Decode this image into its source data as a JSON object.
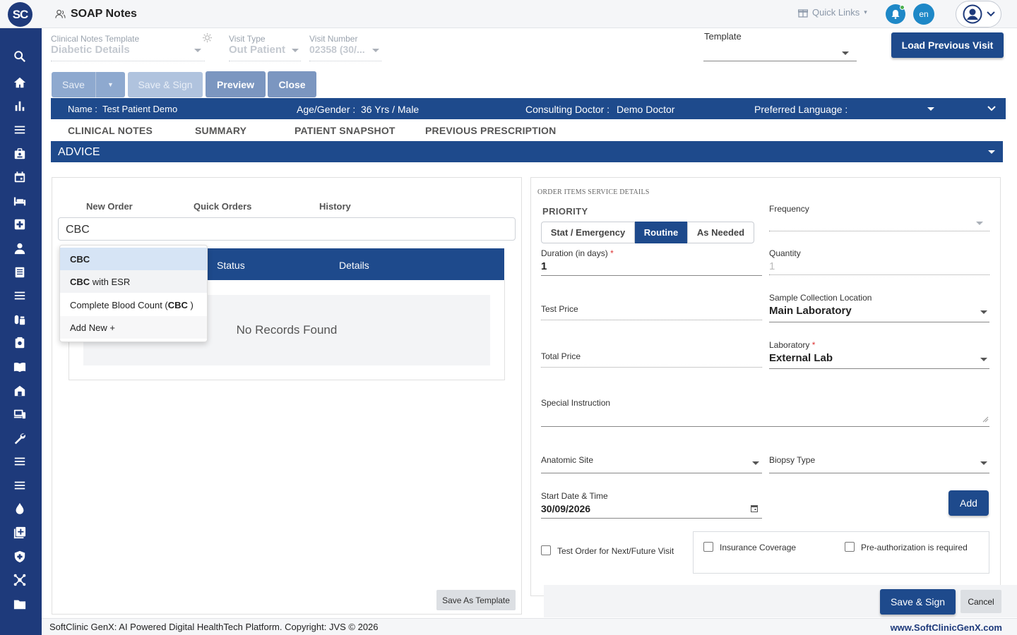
{
  "header": {
    "logo_text": "SC",
    "app_title": "SOAP Notes",
    "quick_links": "Quick Links",
    "lang_badge": "en"
  },
  "form": {
    "clinical_template_label": "Clinical Notes Template",
    "clinical_template_value": "Diabetic Details",
    "visit_type_label": "Visit Type",
    "visit_type_value": "Out Patient",
    "visit_number_label": "Visit Number",
    "visit_number_value": "02358 (30/...",
    "template_label": "Template",
    "load_previous_label": "Load Previous Visit"
  },
  "toolbar": {
    "save_label": "Save",
    "save_sign_label": "Save & Sign",
    "preview_label": "Preview",
    "close_label": "Close"
  },
  "patient": {
    "name_label": "Name :",
    "name_value": "Test Patient Demo",
    "age_label": "Age/Gender :",
    "age_value": "36 Yrs / Male",
    "doctor_label": "Consulting Doctor :",
    "doctor_value": "Demo Doctor",
    "language_label": "Preferred Language :"
  },
  "tabs": [
    "CLINICAL NOTES",
    "SUMMARY",
    "PATIENT SNAPSHOT",
    "PREVIOUS PRESCRIPTION"
  ],
  "section_title": "ADVICE",
  "orders": {
    "subtabs": [
      "New Order",
      "Quick Orders",
      "History"
    ],
    "search_value": "CBC",
    "columns": [
      "Status",
      "Details"
    ],
    "empty_message": "No Records Found",
    "suggestions": [
      {
        "bold": "CBC",
        "rest": ""
      },
      {
        "bold": "CBC",
        "rest": " with ESR"
      },
      {
        "pre": "Complete Blood Count (",
        "bold": "CBC",
        "post": " )"
      },
      {
        "pre": "Add New +"
      }
    ],
    "save_template_label": "Save As Template"
  },
  "service_details": {
    "header": "ORDER ITEMS SERVICE DETAILS",
    "priority_label": "PRIORITY",
    "priority_options": [
      "Stat / Emergency",
      "Routine",
      "As Needed"
    ],
    "priority_selected": "Routine",
    "frequency_label": "Frequency",
    "duration_label": "Duration (in days)",
    "duration_value": "1",
    "quantity_label": "Quantity",
    "quantity_value": "1",
    "test_price_label": "Test Price",
    "sample_location_label": "Sample Collection Location",
    "sample_location_value": "Main Laboratory",
    "total_price_label": "Total Price",
    "laboratory_label": "Laboratory",
    "laboratory_value": "External Lab",
    "special_instruction_label": "Special Instruction",
    "anatomic_site_label": "Anatomic Site",
    "biopsy_type_label": "Biopsy Type",
    "start_date_label": "Start Date & Time",
    "start_date_value": "30/09/2026",
    "add_label": "Add",
    "future_visit_label": "Test Order for Next/Future Visit",
    "insurance_label": "Insurance Coverage",
    "preauth_label": "Pre-authorization is required",
    "save_sign_label": "Save & Sign",
    "cancel_label": "Cancel"
  },
  "footer": {
    "copyright": "SoftClinic GenX: AI Powered Digital HealthTech Platform. Copyright: JVS © 2026",
    "website": "www.SoftClinicGenX.com"
  },
  "colors": {
    "primary": "#1e4a8c",
    "sidebar": "#1e3a7b",
    "accent": "#1e88c7"
  }
}
